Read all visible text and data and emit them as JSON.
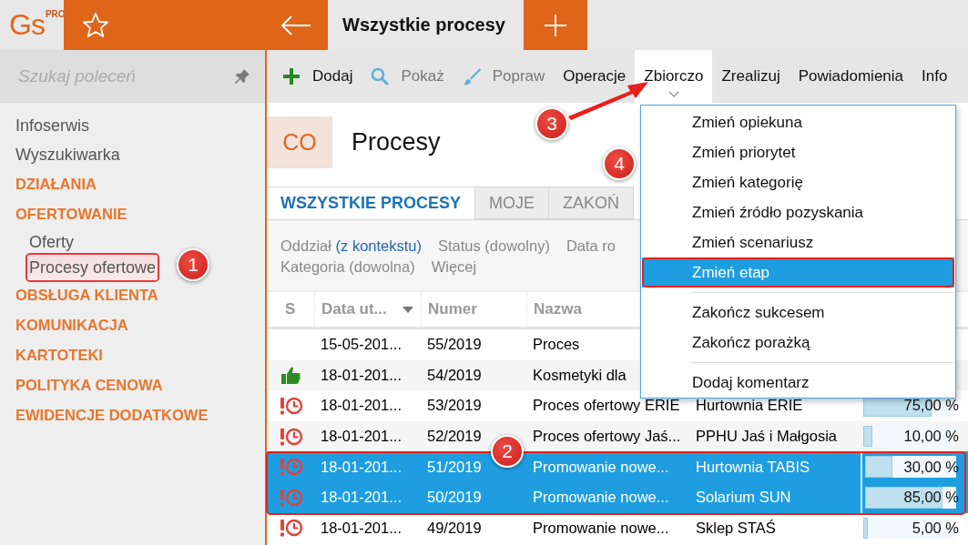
{
  "app": {
    "logo": "Gs",
    "logo_badge": "PRO"
  },
  "doc_tabs": [
    {
      "label": "Wszystkie procesy",
      "selected": true
    }
  ],
  "sidebar": {
    "search": {
      "placeholder": "Szukaj poleceń"
    },
    "items": [
      {
        "label": "Infoserwis",
        "kind": "link",
        "selected": false
      },
      {
        "label": "Wyszukiwarka",
        "kind": "link",
        "selected": false
      },
      {
        "label": "DZIAŁANIA",
        "kind": "section",
        "selected": false
      },
      {
        "label": "OFERTOWANIE",
        "kind": "section",
        "selected": false,
        "children": [
          {
            "label": "Oferty",
            "kind": "link",
            "selected": false
          },
          {
            "label": "Procesy ofertowe",
            "kind": "link",
            "selected": true
          }
        ]
      },
      {
        "label": "OBSŁUGA KLIENTA",
        "kind": "section",
        "selected": false
      },
      {
        "label": "KOMUNIKACJA",
        "kind": "section",
        "selected": false
      },
      {
        "label": "KARTOTEKI",
        "kind": "section",
        "selected": false
      },
      {
        "label": "POLITYKA CENOWA",
        "kind": "section",
        "selected": false
      },
      {
        "label": "EWIDENCJE DODATKOWE",
        "kind": "section",
        "selected": false
      }
    ]
  },
  "toolbar": [
    {
      "label": "Dodaj",
      "disabled": false,
      "open": false
    },
    {
      "label": "Pokaż",
      "disabled": true,
      "open": false
    },
    {
      "label": "Popraw",
      "disabled": true,
      "open": false
    },
    {
      "label": "Operacje",
      "disabled": false,
      "open": false
    },
    {
      "label": "Zbiorczo",
      "disabled": false,
      "open": true
    },
    {
      "label": "Zrealizuj",
      "disabled": false,
      "open": false
    },
    {
      "label": "Powiadomienia",
      "disabled": false,
      "open": false
    },
    {
      "label": "Info",
      "disabled": false,
      "open": false
    }
  ],
  "page": {
    "badge": "CO",
    "title": "Procesy"
  },
  "view_tabs": [
    {
      "label": "WSZYSTKIE PROCESY",
      "selected": true
    },
    {
      "label": "MOJE",
      "selected": false
    },
    {
      "label": "ZAKOŃ",
      "selected": false
    }
  ],
  "filters": [
    [
      {
        "label": "Oddział",
        "value": "(z kontekstu)"
      },
      {
        "label": "Status (dowolny)"
      },
      {
        "label": "Data ro"
      }
    ],
    [
      {
        "label": "Kategoria (dowolna)"
      },
      {
        "label": "Więcej"
      }
    ]
  ],
  "table": {
    "columns": [
      {
        "label": "S",
        "sorted": false
      },
      {
        "label": "Data ut...",
        "sorted": true
      },
      {
        "label": "Numer",
        "sorted": false
      },
      {
        "label": "Nazwa",
        "sorted": false
      }
    ],
    "rows": [
      {
        "kind": "plain",
        "date": "15-05-201...",
        "number": "55/2019",
        "name": "Proces",
        "selected": false
      },
      {
        "kind": "won",
        "date": "18-01-201...",
        "number": "54/2019",
        "name": "Kosmetyki dla",
        "selected": false
      },
      {
        "kind": "overdue",
        "date": "18-01-201...",
        "number": "53/2019",
        "name": "Proces ofertowy ERIE",
        "client": "Hurtownia ERIE",
        "level": 0.75,
        "percent": "75,00 %",
        "selected": false
      },
      {
        "kind": "overdue",
        "date": "18-01-201...",
        "number": "52/2019",
        "name": "Proces ofertowy Jaś...",
        "client": "PPHU Jaś i Małgosia",
        "level": 0.1,
        "percent": "10,00 %",
        "selected": false
      },
      {
        "kind": "overdue",
        "date": "18-01-201...",
        "number": "51/2019",
        "name": "Promowanie nowe...",
        "client": "Hurtownia TABIS",
        "level": 0.3,
        "percent": "30,00 %",
        "selected": true
      },
      {
        "kind": "overdue",
        "date": "18-01-201...",
        "number": "50/2019",
        "name": "Promowanie nowe...",
        "client": "Solarium SUN",
        "level": 0.85,
        "percent": "85,00 %",
        "selected": true
      },
      {
        "kind": "overdue",
        "date": "18-01-201...",
        "number": "49/2019",
        "name": "Promowanie nowe...",
        "client": "Sklep STAŚ",
        "level": 0.05,
        "percent": "5,00 %",
        "selected": false
      }
    ]
  },
  "menu": {
    "groups": [
      [
        {
          "label": "Zmień opiekuna",
          "selected": false
        },
        {
          "label": "Zmień priorytet",
          "selected": false
        },
        {
          "label": "Zmień kategorię",
          "selected": false
        },
        {
          "label": "Zmień źródło pozyskania",
          "selected": false
        },
        {
          "label": "Zmień scenariusz",
          "selected": false
        },
        {
          "label": "Zmień etap",
          "selected": true
        }
      ],
      [
        {
          "label": "Zakończ sukcesem",
          "selected": false
        },
        {
          "label": "Zakończ porażką",
          "selected": false
        }
      ],
      [
        {
          "label": "Dodaj komentarz",
          "selected": false
        }
      ]
    ]
  },
  "callouts": [
    "1",
    "2",
    "3",
    "4"
  ]
}
